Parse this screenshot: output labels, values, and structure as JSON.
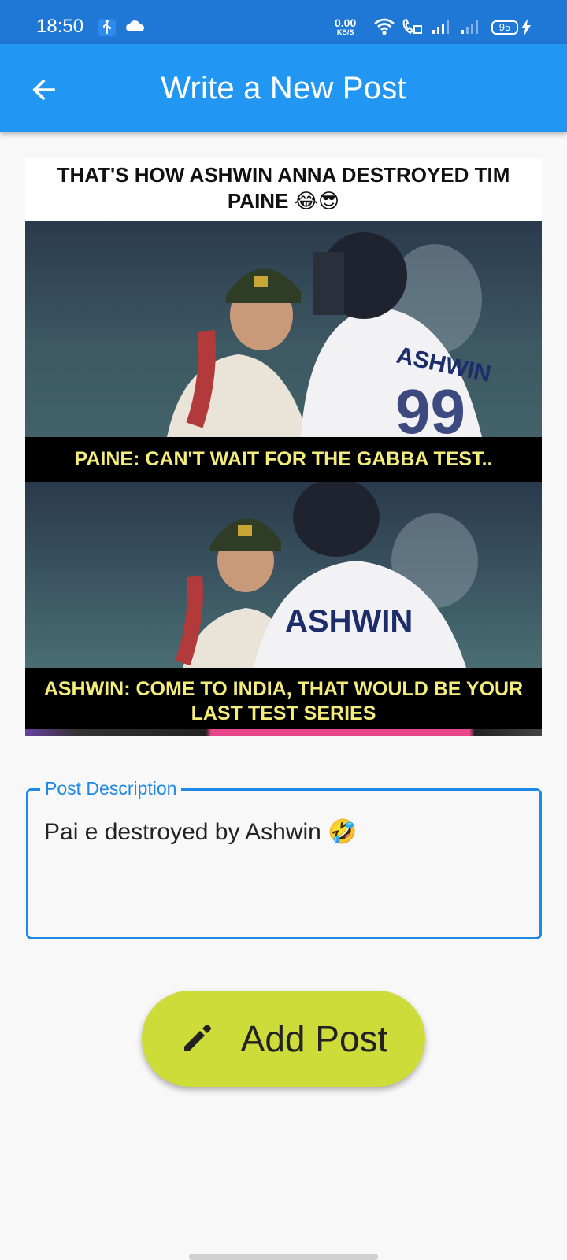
{
  "status_bar": {
    "time": "18:50",
    "net_speed": "0.00",
    "net_unit": "KB/S",
    "battery": "95",
    "icons": [
      "usb-debug-icon",
      "cloud-icon",
      "wifi-icon",
      "wifi-call-icon",
      "signal-icon",
      "signal-icon",
      "battery-icon",
      "charging-icon"
    ]
  },
  "app_bar": {
    "title": "Write a New Post",
    "back_icon": "arrow-back-icon",
    "color": "#2196f3"
  },
  "meme": {
    "header": "THAT'S HOW ASHWIN ANNA DESTROYED TIM PAINE",
    "header_emojis": "😂😎",
    "caption_1": "PAINE: CAN'T WAIT FOR THE GABBA TEST..",
    "caption_2": "ASHWIN: COME TO INDIA, THAT WOULD BE YOUR LAST TEST SERIES",
    "jersey_text": "ASHWIN",
    "caption_color": "#f3ec7a"
  },
  "post_description": {
    "label": "Post Description",
    "value": "Pai e destroyed by Ashwin",
    "value_emoji": "🤣",
    "accent": "#1e88e5"
  },
  "add_button": {
    "label": "Add Post",
    "icon": "edit-icon",
    "color": "#cddc39"
  }
}
